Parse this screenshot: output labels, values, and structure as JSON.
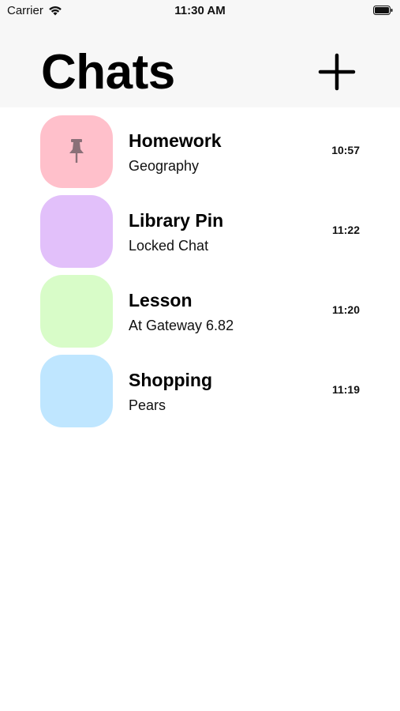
{
  "status_bar": {
    "carrier": "Carrier",
    "time": "11:30 AM",
    "wifi_icon": "wifi-icon",
    "battery_icon": "battery-icon"
  },
  "header": {
    "title": "Chats",
    "add_icon": "plus-icon"
  },
  "chats": [
    {
      "title": "Homework",
      "subtitle": "Geography",
      "time": "10:57",
      "color": "#ffc0cb",
      "pinned": true
    },
    {
      "title": "Library Pin",
      "subtitle": "Locked Chat",
      "time": "11:22",
      "color": "#e2c0fa",
      "pinned": false
    },
    {
      "title": "Lesson",
      "subtitle": "At Gateway 6.82",
      "time": "11:20",
      "color": "#d8fcc8",
      "pinned": false
    },
    {
      "title": "Shopping",
      "subtitle": "Pears",
      "time": "11:19",
      "color": "#bfe6ff",
      "pinned": false
    }
  ]
}
